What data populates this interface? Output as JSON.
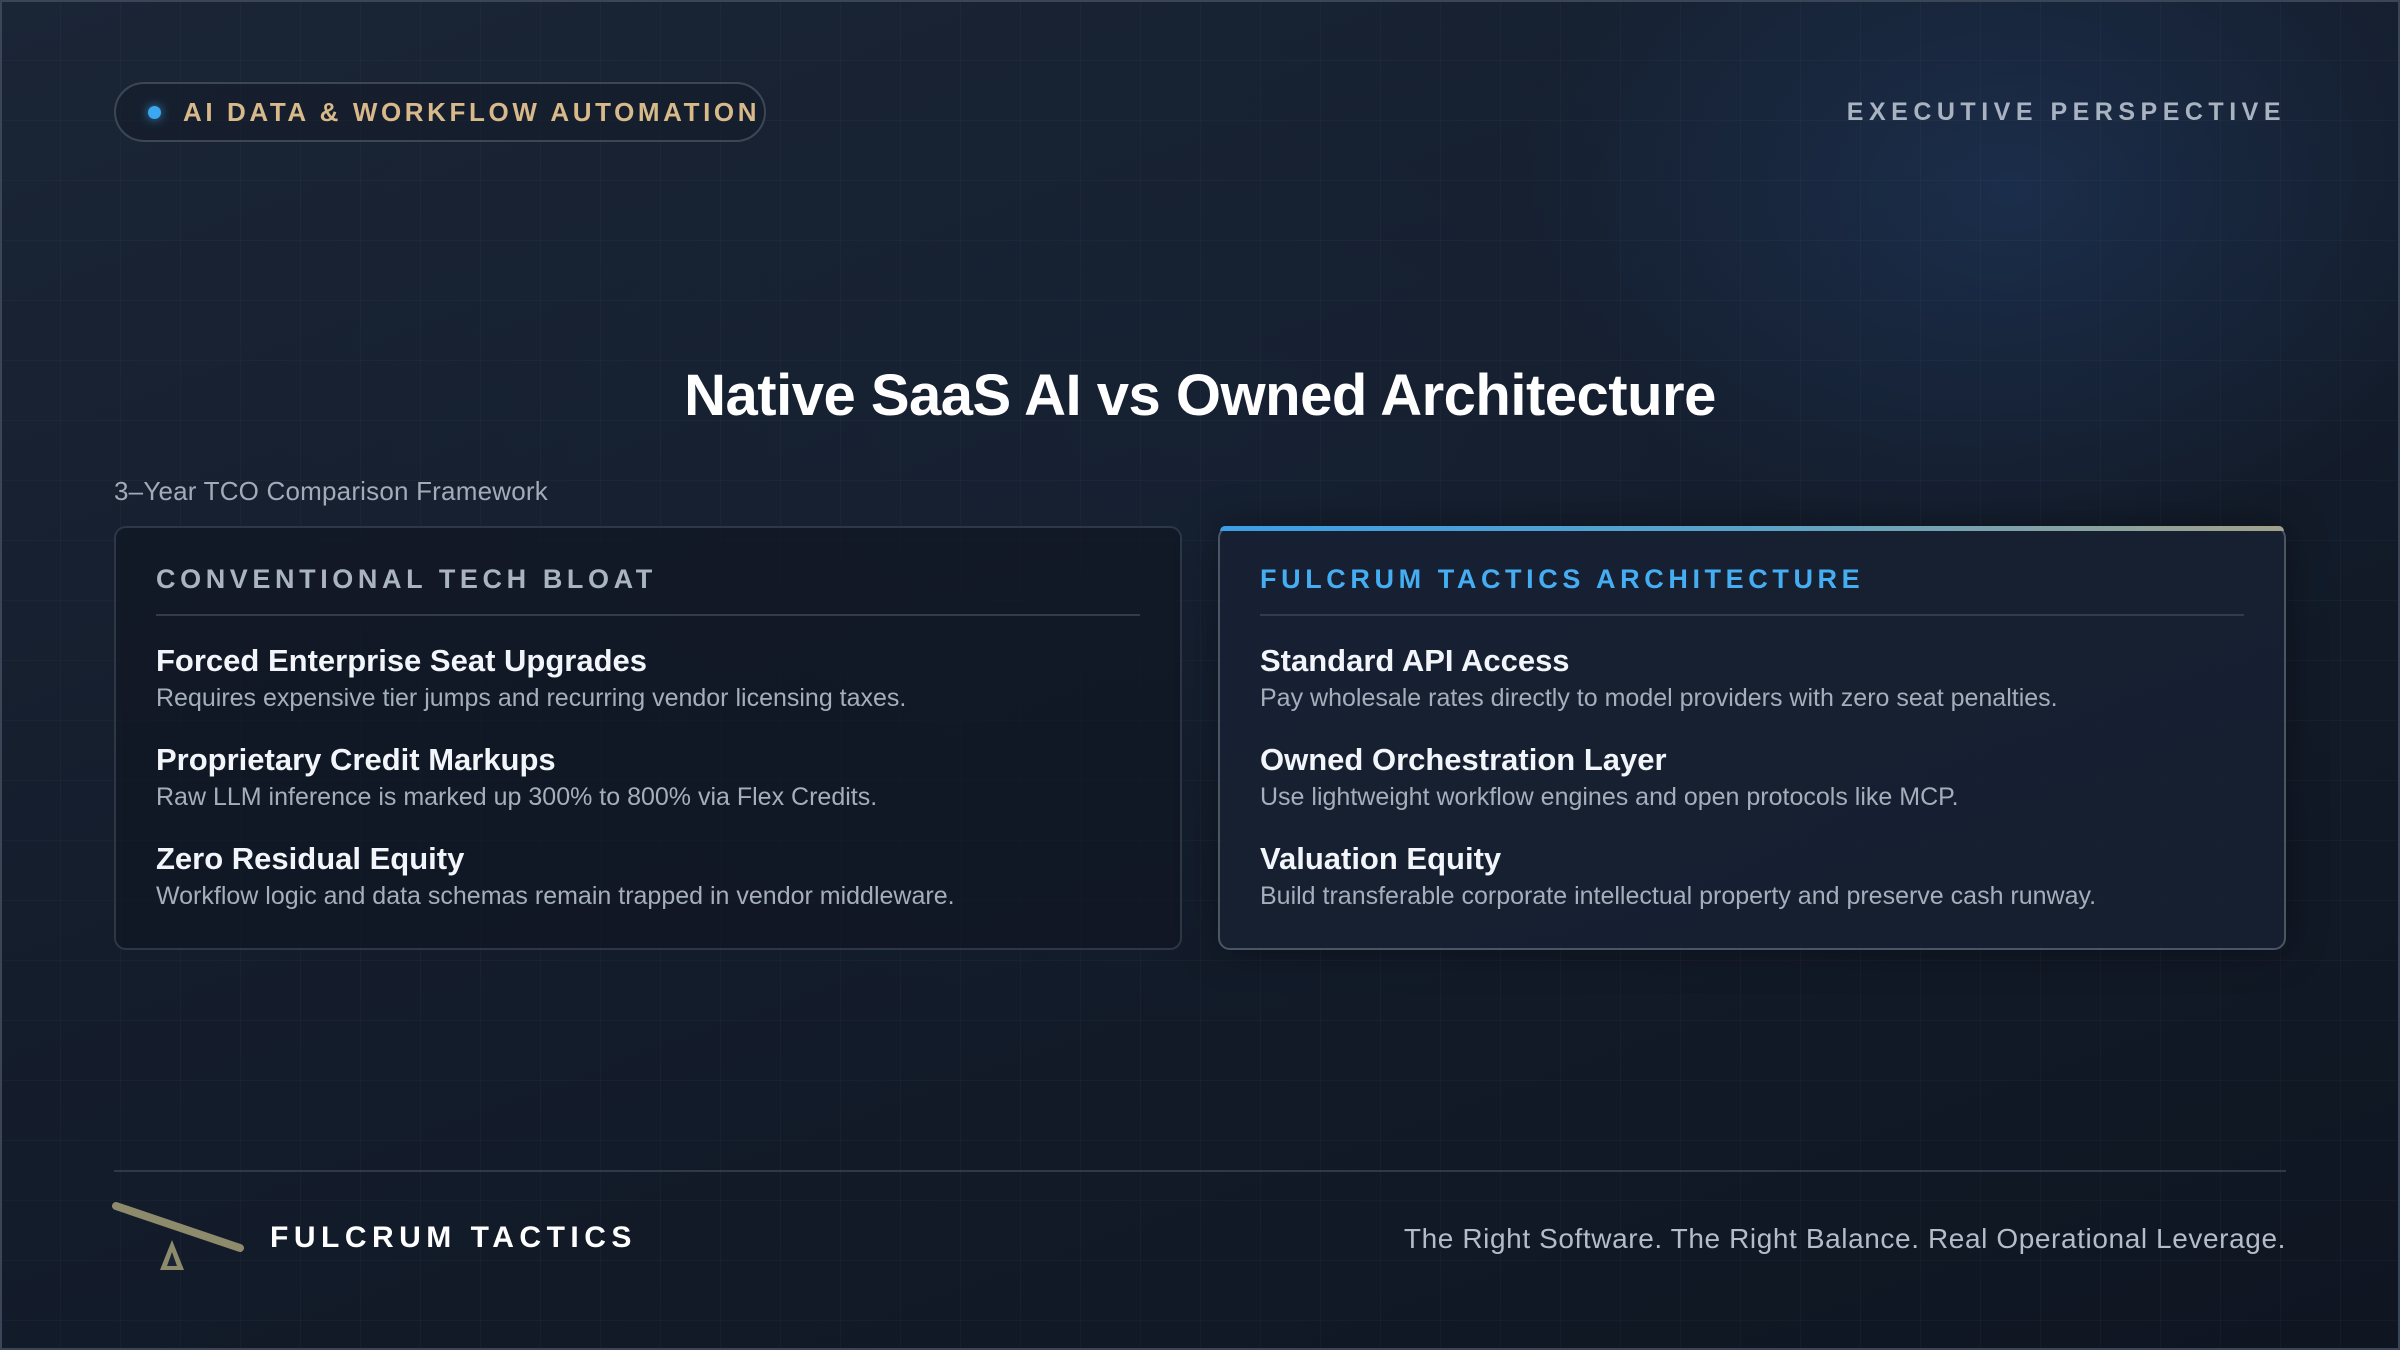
{
  "header": {
    "pill_label": "AI DATA & WORKFLOW AUTOMATION",
    "top_right_label": "EXECUTIVE PERSPECTIVE"
  },
  "title": "Native SaaS AI vs Owned Architecture",
  "subtitle": "3–Year TCO Comparison Framework",
  "cards": [
    {
      "heading": "CONVENTIONAL TECH BLOAT",
      "items": [
        {
          "title": "Forced Enterprise Seat Upgrades",
          "desc": "Requires expensive tier jumps and recurring vendor licensing taxes."
        },
        {
          "title": "Proprietary Credit Markups",
          "desc": "Raw LLM inference is marked up 300% to 800% via Flex Credits."
        },
        {
          "title": "Zero Residual Equity",
          "desc": "Workflow logic and data schemas remain trapped in vendor middleware."
        }
      ]
    },
    {
      "heading": "FULCRUM TACTICS ARCHITECTURE",
      "items": [
        {
          "title": "Standard API Access",
          "desc": "Pay wholesale rates directly to model providers with zero seat penalties."
        },
        {
          "title": "Owned Orchestration Layer",
          "desc": "Use lightweight workflow engines and open protocols like MCP."
        },
        {
          "title": "Valuation Equity",
          "desc": "Build transferable corporate intellectual property and preserve cash runway."
        }
      ]
    }
  ],
  "footer": {
    "brand": "FULCRUM TACTICS",
    "tagline": "The Right Software. The Right Balance. Real Operational Leverage.",
    "logo_icon": "fulcrum-lever-icon"
  },
  "colors": {
    "background": "#141d2c",
    "accent_blue": "#45aef3",
    "accent_gold": "#d7b98a",
    "logo_olive": "#8e8b6c"
  }
}
